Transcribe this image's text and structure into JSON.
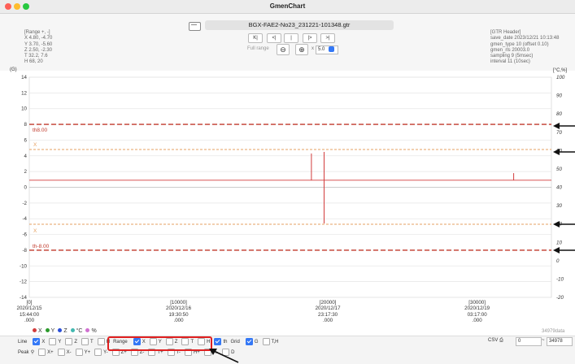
{
  "window": {
    "title": "GmenChart"
  },
  "file": {
    "name": "BGX-FAE2-No23_231221-101348.gtr"
  },
  "range_info": {
    "lines": [
      "[Range +, -]",
      "X  4.80, -4.70",
      "Y  3.70, -5.60",
      "Z  2.50, -2.30",
      "T  32.2, 7.6",
      "H  68, 20"
    ]
  },
  "gtr_header": {
    "lines": [
      "[GTR Header]",
      "save_date 2023/12/21 10:13:48",
      "gmen_type 10 (offset 0.10)",
      "gmen_rls 20003.0",
      "sampling 9 (5msec)",
      "interval 11 (10sec)"
    ]
  },
  "nav": {
    "buttons": [
      "K|",
      "<|",
      "|",
      "|>",
      ">|"
    ]
  },
  "zoom": {
    "label": "Full range",
    "multiplier": "x",
    "value": "5.0"
  },
  "axes": {
    "left_unit": "(G)",
    "right_unit": "[°C,%]",
    "left_ticks": [
      "14",
      "12",
      "10",
      "8",
      "6",
      "4",
      "2",
      "0",
      "-2",
      "-4",
      "-6",
      "-8",
      "-10",
      "-12",
      "-14"
    ],
    "right_ticks": [
      "100",
      "90",
      "80",
      "70",
      "60",
      "50",
      "40",
      "30",
      "20",
      "10",
      "0",
      "-10",
      "-20"
    ]
  },
  "chart_data": {
    "type": "line",
    "ylim_left": [
      -14,
      14
    ],
    "ylim_right": [
      -20,
      100
    ],
    "thresholds": [
      {
        "label": "th8.00",
        "value": 8.0,
        "color": "#c0392b"
      },
      {
        "label": "th-8.00",
        "value": -8.0,
        "color": "#c0392b"
      }
    ],
    "range_lines": [
      {
        "label": "X",
        "value": 4.8,
        "color": "#e5a060"
      },
      {
        "label": "X",
        "value": -4.7,
        "color": "#e5a060"
      }
    ],
    "series": [
      {
        "name": "X",
        "color": "#d23c3c",
        "baseline": 0.9,
        "spikes": [
          {
            "x": 18900,
            "y": 4.3
          },
          {
            "x": 19750,
            "y": 4.5
          },
          {
            "x": 19750,
            "y": -4.6
          },
          {
            "x": 32450,
            "y": 1.8
          }
        ]
      }
    ],
    "x_ticks": [
      {
        "index": "[0]",
        "date": "2020/12/15",
        "time": "15:44:00",
        "ms": ".000"
      },
      {
        "index": "[10000]",
        "date": "2020/12/16",
        "time": "19:30:50",
        "ms": ".000"
      },
      {
        "index": "[20000]",
        "date": "2020/12/17",
        "time": "23:17:30",
        "ms": ".000"
      },
      {
        "index": "[30000]",
        "date": "2020/12/19",
        "time": "03:17:00",
        "ms": ".000"
      }
    ],
    "data_count": "34979data",
    "grid": true
  },
  "legend": [
    {
      "label": "X",
      "color": "#d23c3c"
    },
    {
      "label": "Y",
      "color": "#2c9a2c"
    },
    {
      "label": "Z",
      "color": "#2a4fd8"
    },
    {
      "label": "°C",
      "color": "#42b8b0"
    },
    {
      "label": "%",
      "color": "#d070d0"
    }
  ],
  "controls": {
    "line_label": "Line",
    "line_items": [
      {
        "label": "X",
        "on": true
      },
      {
        "label": "Y",
        "on": false
      },
      {
        "label": "Z",
        "on": false
      },
      {
        "label": "T",
        "on": false
      },
      {
        "label": "H",
        "on": false
      }
    ],
    "range_label": "Range",
    "range_items": [
      {
        "label": "X",
        "on": true
      },
      {
        "label": "Y",
        "on": false
      },
      {
        "label": "Z",
        "on": false
      },
      {
        "label": "T",
        "on": false
      },
      {
        "label": "H",
        "on": false
      },
      {
        "label": "th",
        "on": true
      }
    ],
    "grid_label": "Grid",
    "grid_items": [
      {
        "label": "G",
        "on": true
      },
      {
        "label": "T,H",
        "on": false
      }
    ],
    "peak_label": "Peak",
    "peak_items": [
      "X+",
      "X-",
      "Y+",
      "Y-",
      "Z+",
      "Z-",
      "T+",
      "T-",
      "H+",
      "H-",
      "D"
    ],
    "csv_label": "CSV",
    "range_from": "0",
    "range_sep": "~",
    "range_to": "34978"
  }
}
